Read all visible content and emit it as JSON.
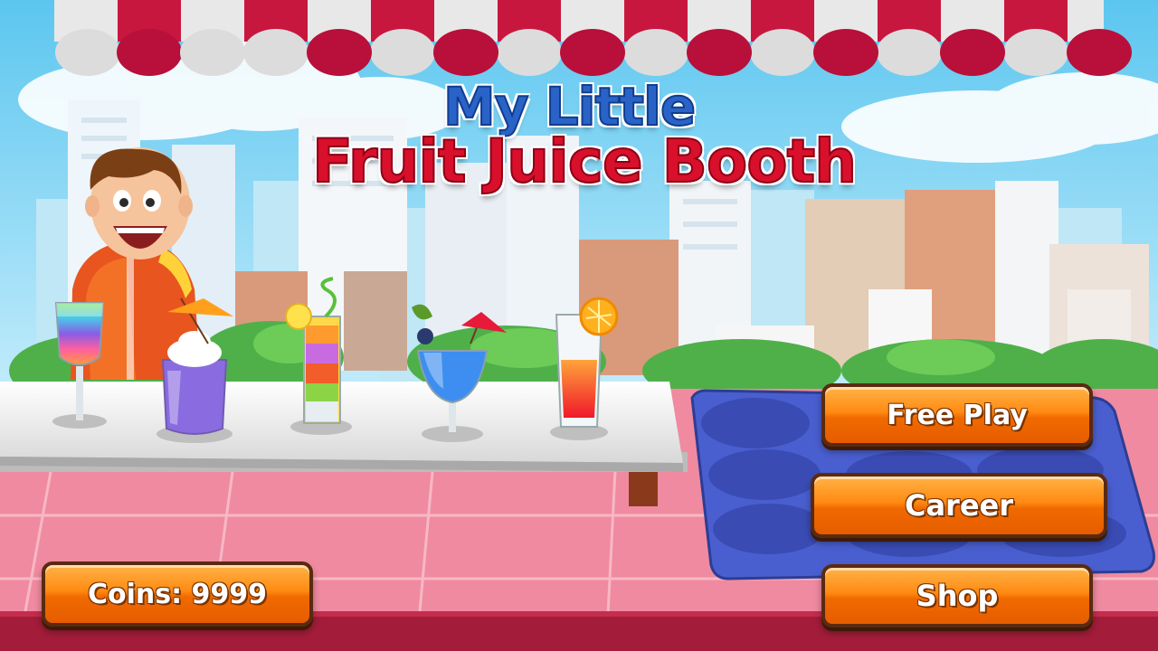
{
  "title": {
    "line1": "My Little",
    "line2": "Fruit Juice Booth"
  },
  "menu": {
    "free_play": "Free Play",
    "career": "Career",
    "shop": "Shop"
  },
  "status": {
    "coins": "Coins: 9999"
  },
  "scene": {
    "drinks": [
      "rainbow-cocktail-glass",
      "purple-smoothie-whipped-cream",
      "layered-juice-shot",
      "blue-cocktail-glass",
      "orange-red-juice-glass"
    ],
    "colors": {
      "sky": "#8fd8f5",
      "awning_red": "#c8173f",
      "awning_white": "#e8e8e8",
      "floor_pink": "#f08aa0",
      "button_orange": "#ff8a12",
      "tray_blue": "#4a5fcf"
    }
  }
}
